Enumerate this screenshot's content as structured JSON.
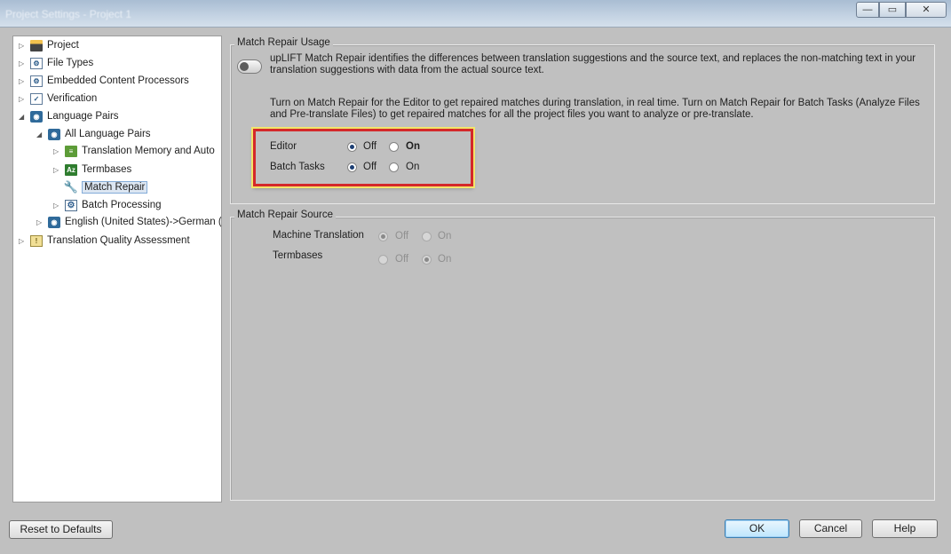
{
  "window": {
    "title": "Project Settings - Project 1",
    "controls": {
      "minimize": "—",
      "maximize": "▭",
      "close": "✕"
    }
  },
  "tree": {
    "items": [
      {
        "label": "Project",
        "icon": "project-icon"
      },
      {
        "label": "File Types",
        "icon": "file-types-icon"
      },
      {
        "label": "Embedded Content Processors",
        "icon": "embedded-content-icon"
      },
      {
        "label": "Verification",
        "icon": "verification-icon"
      },
      {
        "label": "Language Pairs",
        "icon": "language-pairs-icon"
      },
      {
        "label": "All Language Pairs",
        "icon": "language-pairs-icon"
      },
      {
        "label": "Translation Memory and Auto",
        "icon": "translation-memory-icon"
      },
      {
        "label": "Termbases",
        "icon": "termbases-icon"
      },
      {
        "label": "Match Repair",
        "icon": "wrench-icon",
        "selected": true
      },
      {
        "label": "Batch Processing",
        "icon": "gear-icon"
      },
      {
        "label": "English (United States)->German (",
        "icon": "language-pairs-icon"
      },
      {
        "label": "Translation Quality Assessment",
        "icon": "quality-assessment-icon"
      }
    ]
  },
  "usage": {
    "title": "Match Repair Usage",
    "description": "upLIFT Match Repair identifies the differences between translation suggestions and the source text, and replaces the non-matching text in your translation suggestions with data from the actual source text.",
    "instructions": "Turn on Match Repair for the Editor to get repaired matches during translation, in real time. Turn on Match Repair for Batch Tasks (Analyze Files and Pre-translate Files) to get repaired matches for all the project files you want to analyze or pre-translate.",
    "options": [
      {
        "label": "Editor",
        "off": "Off",
        "on": "On",
        "selected": "Off"
      },
      {
        "label": "Batch Tasks",
        "off": "Off",
        "on": "On",
        "selected": "Off"
      }
    ]
  },
  "source": {
    "title": "Match Repair Source",
    "options": [
      {
        "label": "Machine Translation",
        "off": "Off",
        "on": "On",
        "selected": "Off"
      },
      {
        "label": "Termbases",
        "off": "Off",
        "on": "On",
        "selected": "On"
      }
    ]
  },
  "buttons": {
    "reset": "Reset to Defaults",
    "ok": "OK",
    "cancel": "Cancel",
    "help": "Help"
  },
  "colors": {
    "highlight_border": "#d4282a",
    "highlight_glow": "#f3e56a",
    "dialog_background": "#c0c0c0"
  }
}
